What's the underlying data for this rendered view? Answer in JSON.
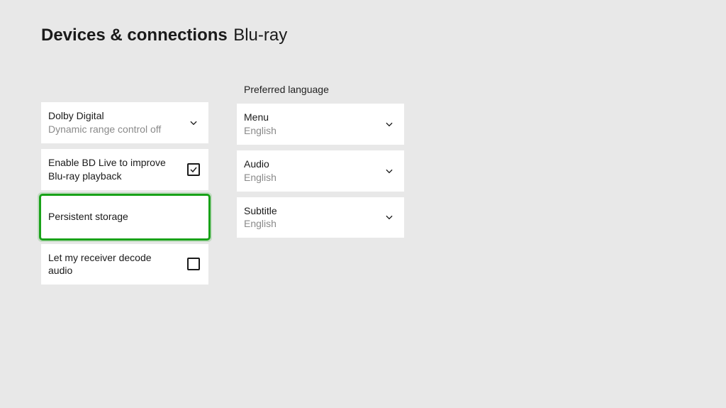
{
  "header": {
    "title_main": "Devices & connections",
    "title_sub": "Blu-ray"
  },
  "left": {
    "dolby": {
      "label": "Dolby Digital",
      "value": "Dynamic range control off"
    },
    "bdlive": {
      "label": "Enable BD Live to improve Blu-ray playback",
      "checked": true
    },
    "persistent": {
      "label": "Persistent storage"
    },
    "receiver": {
      "label": "Let my receiver decode audio",
      "checked": false
    }
  },
  "right": {
    "section_label": "Preferred language",
    "menu": {
      "label": "Menu",
      "value": "English"
    },
    "audio": {
      "label": "Audio",
      "value": "English"
    },
    "subtitle": {
      "label": "Subtitle",
      "value": "English"
    }
  }
}
